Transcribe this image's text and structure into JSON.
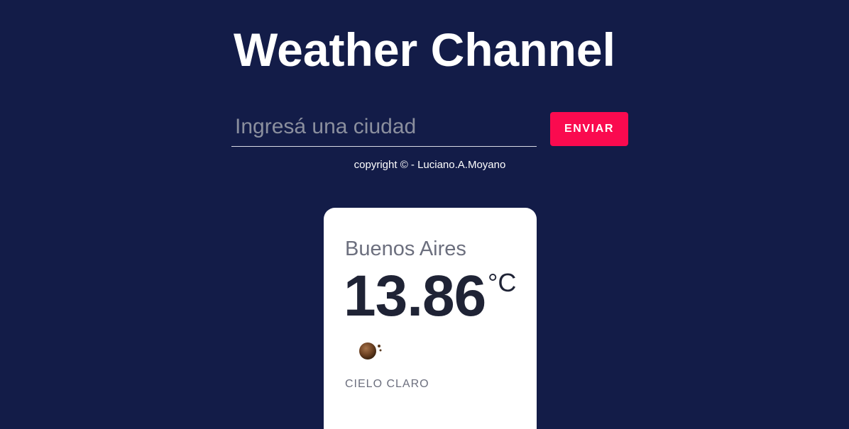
{
  "header": {
    "title": "Weather Channel"
  },
  "search": {
    "placeholder": "Ingresá una ciudad",
    "value": "",
    "button_label": "ENVIAR"
  },
  "footer": {
    "copyright": "copyright © - Luciano.A.Moyano"
  },
  "weather_card": {
    "city": "Buenos Aires",
    "temperature": "13.86",
    "unit": "°C",
    "icon": "clear-sky-icon",
    "description": "CIELO CLARO"
  },
  "colors": {
    "background": "#131c48",
    "accent": "#fa0a4f",
    "card": "#ffffff",
    "text_dark": "#1f2335",
    "text_muted": "#6c6f7e"
  }
}
